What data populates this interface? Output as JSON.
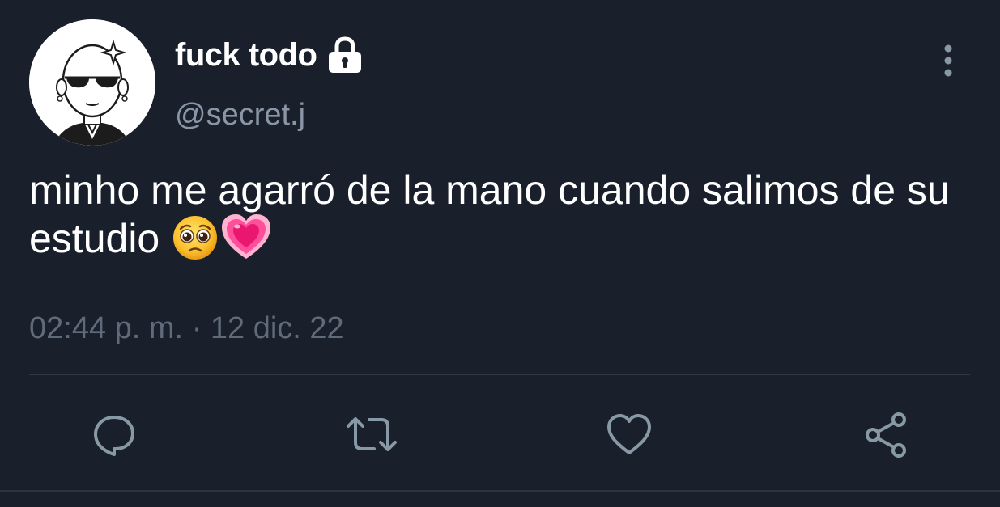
{
  "author": {
    "display_name": "fuck todo",
    "handle": "@secret.j",
    "avatar_icon": "sunglasses-character-avatar",
    "protected_icon": "lock-icon"
  },
  "tweet": {
    "text": "minho me agarró de la mano cuando salimos de su estudio",
    "emojis": [
      "pleading-face",
      "growing-heart"
    ]
  },
  "meta": {
    "time": "02:44 p. m.",
    "separator": "·",
    "date": "12 dic. 22"
  },
  "actions": [
    {
      "icon": "reply-icon"
    },
    {
      "icon": "retweet-icon"
    },
    {
      "icon": "like-icon"
    },
    {
      "icon": "share-icon"
    }
  ],
  "colors": {
    "background": "#1a202b",
    "text": "#ffffff",
    "secondary_text": "#8a96a6",
    "icon": "#8899a6"
  }
}
